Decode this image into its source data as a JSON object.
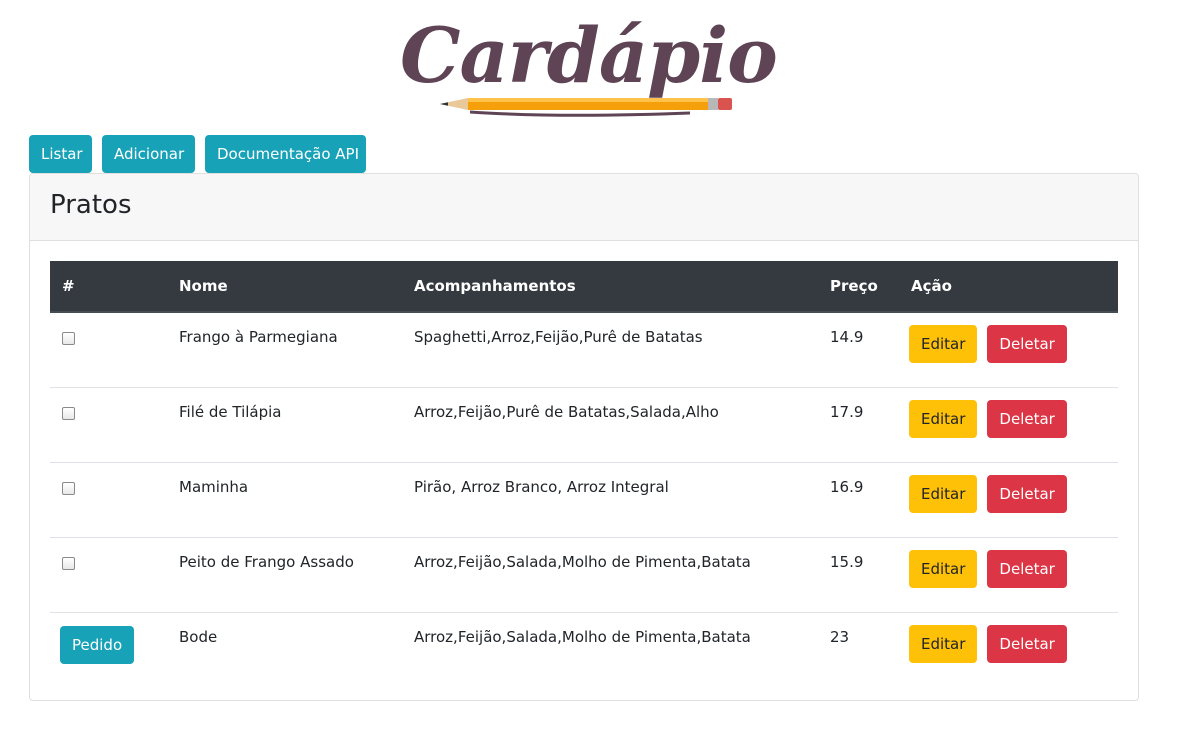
{
  "logo": {
    "text": "Cardápio",
    "color": "#5e4454"
  },
  "nav": {
    "items": [
      "Listar",
      "Adicionar",
      "Documentação API"
    ]
  },
  "card": {
    "title": "Pratos"
  },
  "table": {
    "headers": [
      "#",
      "Nome",
      "Acompanhamentos",
      "Preço",
      "Ação"
    ],
    "rows": [
      {
        "name": "Frango à Parmegiana",
        "sides": "Spaghetti,Arroz,Feijão,Purê de Batatas",
        "price": "14.9",
        "checked": false
      },
      {
        "name": "Filé de Tilápia",
        "sides": "Arroz,Feijão,Purê de Batatas,Salada,Alho",
        "price": "17.9",
        "checked": false
      },
      {
        "name": "Maminha",
        "sides": "Pirão, Arroz Branco, Arroz Integral",
        "price": "16.9",
        "checked": false
      },
      {
        "name": "Peito de Frango Assado",
        "sides": "Arroz,Feijão,Salada,Molho de Pimenta,Batata",
        "price": "15.9",
        "checked": false
      },
      {
        "name": "Bode",
        "sides": "Arroz,Feijão,Salada,Molho de Pimenta,Batata",
        "price": "23",
        "checked": false
      }
    ],
    "edit_label": "Editar",
    "delete_label": "Deletar"
  },
  "order_button": "Pedido",
  "colors": {
    "info": "#17a2b8",
    "warning": "#ffc107",
    "danger": "#dc3545",
    "table_header": "#343a40"
  }
}
